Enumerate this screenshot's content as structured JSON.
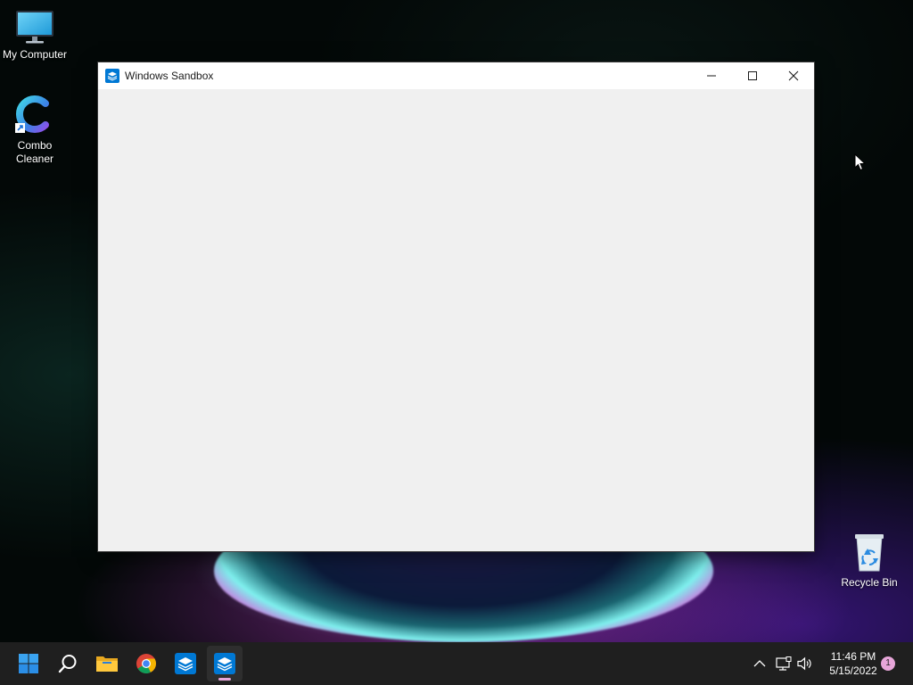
{
  "desktop": {
    "icons": [
      {
        "label": "My Computer",
        "icon": "monitor-icon"
      },
      {
        "label": "Combo\nCleaner",
        "icon": "combo-cleaner-icon"
      },
      {
        "label": "Recycle Bin",
        "icon": "recycle-bin-icon"
      }
    ]
  },
  "window": {
    "title": "Windows Sandbox",
    "icon": "windows-sandbox-icon",
    "controls": [
      "minimize-icon",
      "maximize-icon",
      "close-icon"
    ]
  },
  "taskbar": {
    "items": [
      {
        "name": "start",
        "icon": "windows-logo-icon"
      },
      {
        "name": "search",
        "icon": "search-icon"
      },
      {
        "name": "file-explorer",
        "icon": "folder-icon"
      },
      {
        "name": "chrome",
        "icon": "chrome-icon"
      },
      {
        "name": "windows-sandbox",
        "icon": "windows-sandbox-icon"
      },
      {
        "name": "windows-sandbox-active",
        "icon": "windows-sandbox-icon",
        "active": true
      }
    ],
    "tray": {
      "icons": [
        "chevron-up-icon",
        "network-icon",
        "volume-icon"
      ],
      "time": "11:46 PM",
      "date": "5/15/2022",
      "notification_count": "1"
    }
  },
  "colors": {
    "taskbar": "#1f1f1f",
    "window_client": "#f0f0f0",
    "accent": "#0078d4",
    "active_indicator": "#e7a6d9"
  }
}
